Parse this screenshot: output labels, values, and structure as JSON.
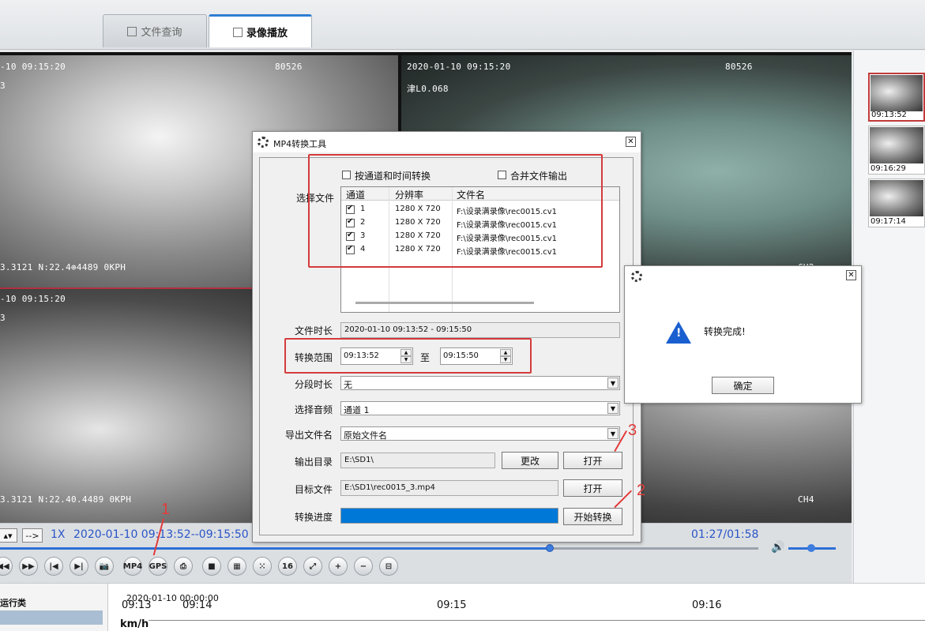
{
  "tabs": [
    {
      "label": "文件查询",
      "icon": "document-icon"
    },
    {
      "label": "录像播放",
      "icon": "film-icon"
    }
  ],
  "panes": {
    "p1": {
      "time": "-10 09:15:20",
      "code": "80526",
      "side": "3",
      "gps": "3.3121 N:22.4⊕4489 0KPH"
    },
    "p2": {
      "time": "2020-01-10 09:15:20",
      "code": "80526",
      "extra": "津L0.068",
      "channel": "CH2"
    },
    "p3": {
      "time": "-10 09:15:20",
      "side": "3",
      "gps": "3.3121 N:22.40.4489 0KPH"
    },
    "p4": {
      "channel": "CH4"
    }
  },
  "thumbnails": [
    {
      "time": "09:13:52",
      "selected": true
    },
    {
      "time": "09:16:29",
      "selected": false
    },
    {
      "time": "09:17:14",
      "selected": false
    }
  ],
  "playback": {
    "next_btn": "-->",
    "speed": "1X",
    "range": "2020-01-10 09:13:52--09:15:50",
    "elapsed": "01:27/01:58",
    "progress": 0.725,
    "volume": 0.4,
    "buttons": [
      {
        "label": "◀◀",
        "name": "rewind-button"
      },
      {
        "label": "▶▶",
        "name": "fast-forward-button"
      },
      {
        "label": "|◀",
        "name": "prev-frame-button"
      },
      {
        "label": "▶|",
        "name": "next-frame-button"
      },
      {
        "label": "📷",
        "name": "snapshot-button"
      },
      {
        "label": "MP4",
        "name": "mp4-convert-button"
      },
      {
        "label": "GPS",
        "name": "gps-button"
      },
      {
        "label": "⎙",
        "name": "print-button"
      },
      {
        "label": "■",
        "name": "stop-button"
      },
      {
        "label": "▦",
        "name": "layout-4-button"
      },
      {
        "label": "⁙",
        "name": "layout-9-button"
      },
      {
        "label": "16",
        "name": "layout-16-button"
      },
      {
        "label": "⤢",
        "name": "fullscreen-button"
      },
      {
        "label": "+",
        "name": "zoom-in-button"
      },
      {
        "label": "−",
        "name": "zoom-out-button"
      },
      {
        "label": "⊟",
        "name": "clip-button"
      }
    ]
  },
  "timeline": {
    "label": "运行类",
    "unit": "km/h",
    "date": "2020-01-10 00:00:00",
    "ticks": [
      "09:13",
      "09:14",
      "09:15",
      "09:16"
    ]
  },
  "mp4_dialog": {
    "title": "MP4转换工具",
    "chk_by_channel": "按通道和时间转换",
    "chk_merge": "合并文件输出",
    "select_file": "选择文件",
    "columns": [
      "通道",
      "分辨率",
      "文件名"
    ],
    "files": [
      {
        "ch": "1",
        "res": "1280 X 720",
        "name": "F:\\设录满录像\\rec0015.cv1"
      },
      {
        "ch": "2",
        "res": "1280 X 720",
        "name": "F:\\设录满录像\\rec0015.cv1"
      },
      {
        "ch": "3",
        "res": "1280 X 720",
        "name": "F:\\设录满录像\\rec0015.cv1"
      },
      {
        "ch": "4",
        "res": "1280 X 720",
        "name": "F:\\设录满录像\\rec0015.cv1"
      }
    ],
    "duration_label": "文件时长",
    "duration": "2020-01-10 09:13:52 - 09:15:50",
    "range_label": "转换范围",
    "range_from": "09:13:52",
    "range_to_label": "至",
    "range_to": "09:15:50",
    "segment_label": "分段时长",
    "segment": "无",
    "audio_label": "选择音频",
    "audio": "通道 1",
    "export_name_label": "导出文件名",
    "export_name": "原始文件名",
    "output_dir_label": "输出目录",
    "output_dir": "E:\\SD1\\",
    "change_btn": "更改",
    "open_btn": "打开",
    "target_label": "目标文件",
    "target": "E:\\SD1\\rec0015_3.mp4",
    "open_btn2": "打开",
    "progress_label": "转换进度",
    "progress": 1.0,
    "start_btn": "开始转换"
  },
  "done_dialog": {
    "message": "转换完成!",
    "ok": "确定"
  },
  "annotations": [
    "1",
    "2",
    "3"
  ],
  "colors": {
    "accent": "#2e6fd8",
    "annotation": "#e23b3b",
    "progress": "#0078d7"
  }
}
